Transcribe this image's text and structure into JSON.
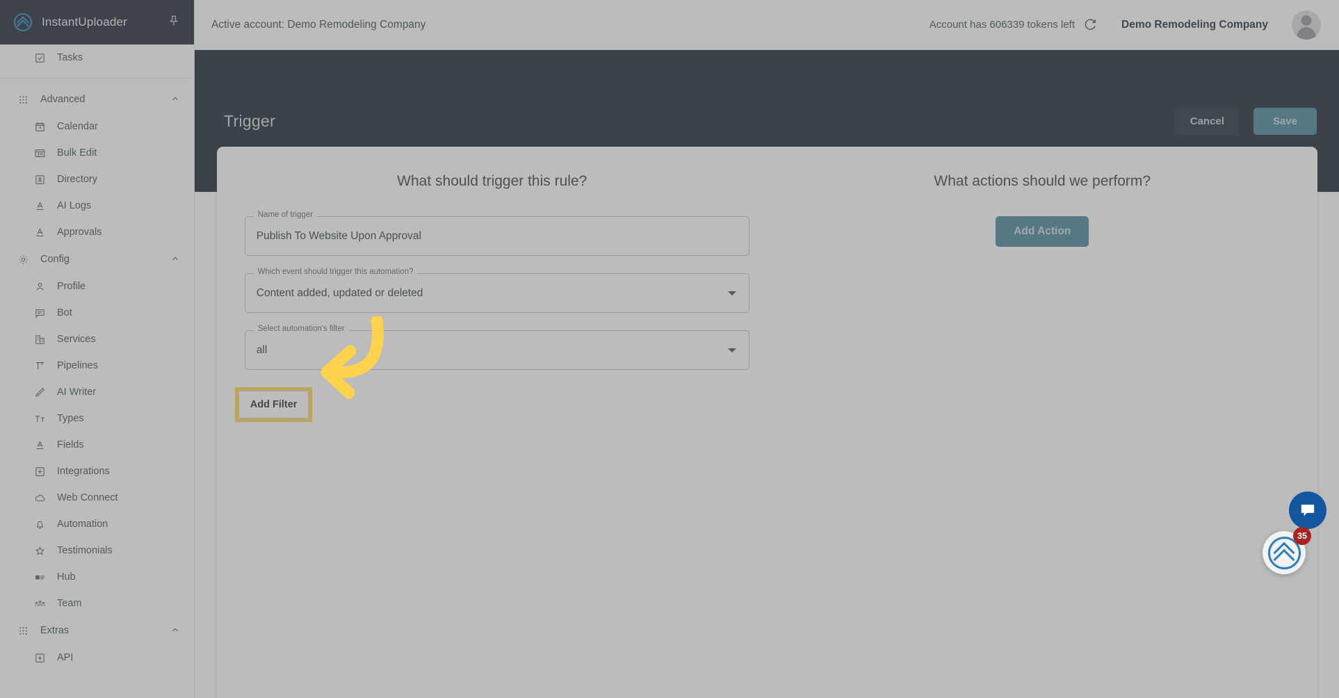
{
  "brand": {
    "name": "InstantUploader",
    "logo_icon": "chevrons-up-circle-icon",
    "pin_icon": "pin-icon"
  },
  "sidebar": {
    "top_items": [
      {
        "label": "Tasks",
        "icon": "checkbox-icon"
      }
    ],
    "groups": [
      {
        "label": "Advanced",
        "icon": "grid-icon",
        "chevron": "chevron-up-icon",
        "items": [
          {
            "label": "Calendar",
            "icon": "calendar-icon"
          },
          {
            "label": "Bulk Edit",
            "icon": "list-edit-icon"
          },
          {
            "label": "Directory",
            "icon": "contact-card-icon"
          },
          {
            "label": "AI Logs",
            "icon": "text-format-icon"
          },
          {
            "label": "Approvals",
            "icon": "text-format-icon"
          }
        ]
      },
      {
        "label": "Config",
        "icon": "gear-icon",
        "chevron": "chevron-up-icon",
        "items": [
          {
            "label": "Profile",
            "icon": "person-icon"
          },
          {
            "label": "Bot",
            "icon": "chat-lines-icon"
          },
          {
            "label": "Services",
            "icon": "building-icon"
          },
          {
            "label": "Pipelines",
            "icon": "pipeline-icon"
          },
          {
            "label": "AI Writer",
            "icon": "pencil-icon"
          },
          {
            "label": "Types",
            "icon": "text-size-icon"
          },
          {
            "label": "Fields",
            "icon": "text-format-icon"
          },
          {
            "label": "Integrations",
            "icon": "plus-box-icon"
          },
          {
            "label": "Web Connect",
            "icon": "cloud-icon"
          },
          {
            "label": "Automation",
            "icon": "bell-icon"
          },
          {
            "label": "Testimonials",
            "icon": "star-icon"
          },
          {
            "label": "Hub",
            "icon": "hub-icon"
          },
          {
            "label": "Team",
            "icon": "people-icon"
          }
        ]
      },
      {
        "label": "Extras",
        "icon": "grid-icon",
        "chevron": "chevron-up-icon",
        "items": [
          {
            "label": "API",
            "icon": "plus-box-icon"
          }
        ]
      }
    ]
  },
  "topbar": {
    "active_account": "Active account: Demo Remodeling Company",
    "tokens_text": "Account has 606339 tokens left",
    "refresh_icon": "refresh-icon",
    "account_name": "Demo Remodeling Company",
    "avatar_icon": "avatar-icon"
  },
  "page_header": {
    "title": "Trigger",
    "cancel_label": "Cancel",
    "save_label": "Save"
  },
  "trigger_panel": {
    "title": "What should trigger this rule?",
    "fields": [
      {
        "label": "Name of trigger",
        "value": "Publish To Website Upon Approval",
        "type": "text"
      },
      {
        "label": "Which event should trigger this automation?",
        "value": "Content added, updated or deleted",
        "type": "select"
      },
      {
        "label": "Select automation's filter",
        "value": "all",
        "type": "select"
      }
    ],
    "add_filter_label": "Add Filter"
  },
  "actions_panel": {
    "title": "What actions should we perform?",
    "add_action_label": "Add Action"
  },
  "widgets": {
    "chat_icon": "chat-icon",
    "helper_icon": "chevrons-up-circle-icon",
    "badge_count": "35"
  },
  "colors": {
    "header_dark": "#0d1b25",
    "accent_teal": "#3c8195",
    "brand_blue": "#1f7fc4",
    "highlight_yellow": "#ffd24d",
    "badge_red": "#a9231f",
    "chat_blue": "#14559f"
  }
}
